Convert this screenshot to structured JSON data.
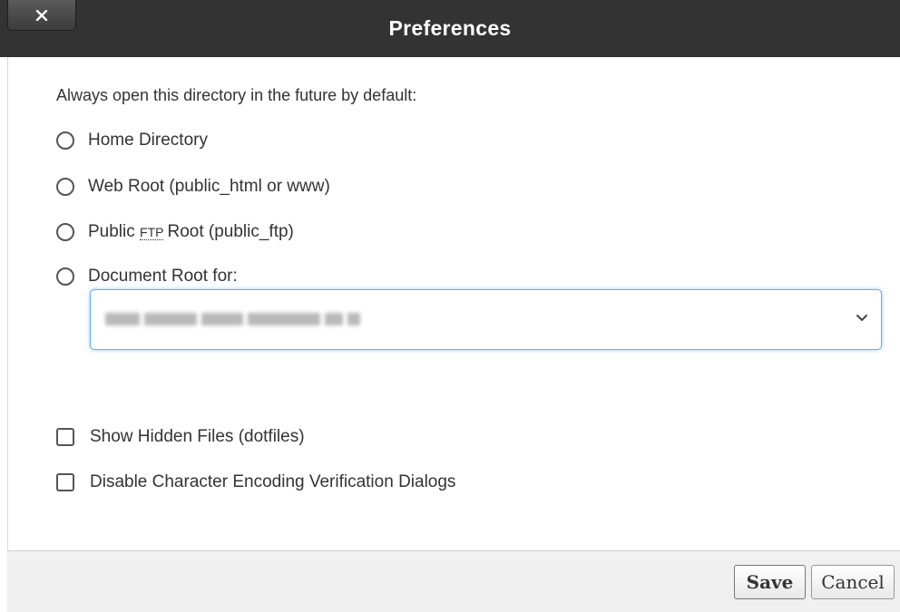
{
  "dialog": {
    "title": "Preferences",
    "close_icon": "close-x-icon"
  },
  "body": {
    "prompt": "Always open this directory in the future by default:",
    "radios": [
      {
        "label": "Home Directory",
        "checked": false
      },
      {
        "label": "Web Root (public_html or www)",
        "checked": false
      },
      {
        "label_before": "Public",
        "abbr": "FTP",
        "label_after": "Root (public_ftp)",
        "checked": false
      },
      {
        "label": "Document Root for:",
        "checked": false
      }
    ],
    "docroot_select": {
      "value": "",
      "value_obscured": true,
      "icon": "chevron-down-icon"
    },
    "checkboxes": [
      {
        "label": "Show Hidden Files (dotfiles)",
        "checked": false
      },
      {
        "label": "Disable Character Encoding Verification Dialogs",
        "checked": false
      }
    ]
  },
  "footer": {
    "save_label": "Save",
    "cancel_label": "Cancel"
  },
  "colors": {
    "titlebar": "#333333",
    "focus_ring": "#66afe9",
    "footer": "#f0f0f0"
  }
}
